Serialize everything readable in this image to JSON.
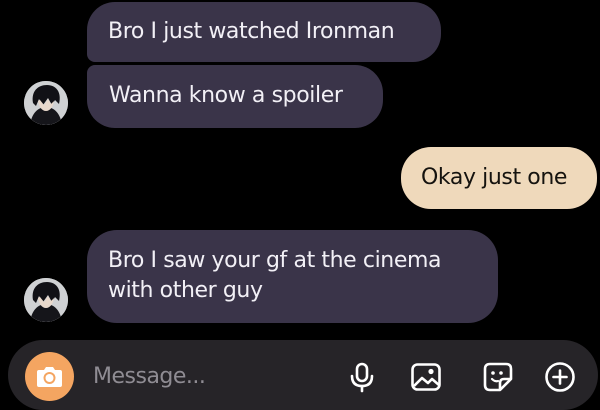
{
  "chat": {
    "messages": [
      {
        "from": "contact",
        "text": "Bro I just watched Ironman"
      },
      {
        "from": "contact",
        "text": "Wanna know a spoiler"
      },
      {
        "from": "me",
        "text": "Okay just one"
      },
      {
        "from": "contact",
        "lines": [
          "Bro I saw your gf at the cinema",
          "with other guy"
        ]
      }
    ]
  },
  "composer": {
    "placeholder": "Message...",
    "icons": [
      "camera-icon",
      "microphone-icon",
      "gallery-icon",
      "sticker-icon",
      "add-icon"
    ]
  },
  "colors": {
    "received_bubble": "#3a3449",
    "sent_bubble": "#efd9bb",
    "camera_button": "#f4a561",
    "composer_bg": "#262428"
  }
}
